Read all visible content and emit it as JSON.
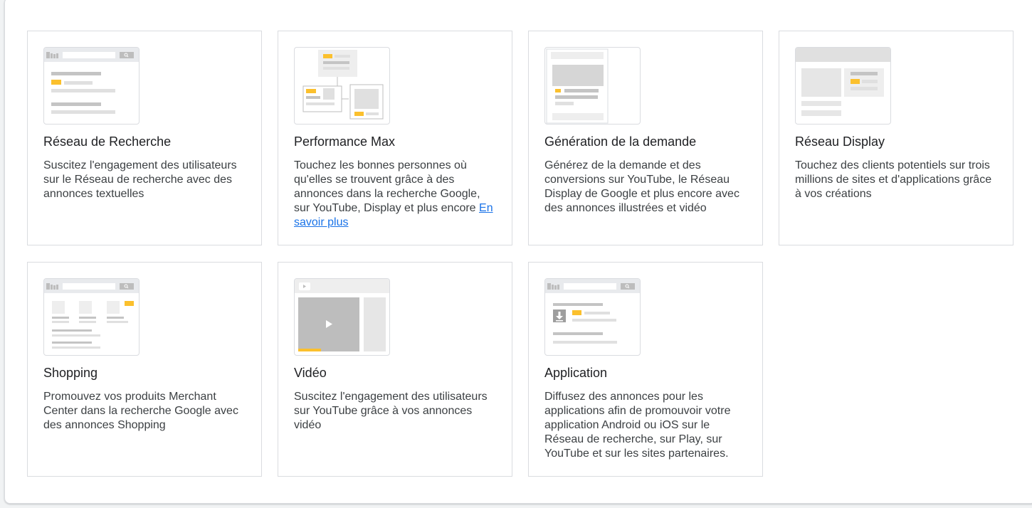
{
  "cards": [
    {
      "title": "Réseau de Recherche",
      "desc": "Suscitez l'engagement des utilisateurs sur le Réseau de recherche avec des annonces textuelles",
      "thumb": "search-network-thumbnail"
    },
    {
      "title": "Performance Max",
      "desc": "Touchez les bonnes personnes où qu'elles se trouvent grâce à des annonces dans la recherche Google, sur YouTube, Display et plus encore",
      "link": "En savoir plus",
      "thumb": "performance-max-thumbnail"
    },
    {
      "title": "Génération de la demande",
      "desc": "Générez de la demande et des conversions sur YouTube, le Réseau Display de Google et plus encore avec des annonces illustrées et vidéo",
      "thumb": "demand-gen-thumbnail"
    },
    {
      "title": "Réseau Display",
      "desc": "Touchez des clients potentiels sur trois millions de sites et d'applications grâce à vos créations",
      "thumb": "display-network-thumbnail"
    },
    {
      "title": "Shopping",
      "desc": "Promouvez vos produits Merchant Center dans la recherche Google avec des annonces Shopping",
      "thumb": "shopping-thumbnail"
    },
    {
      "title": "Vidéo",
      "desc": "Suscitez l'engagement des utilisateurs sur YouTube grâce à vos annonces vidéo",
      "thumb": "video-thumbnail"
    },
    {
      "title": "Application",
      "desc": "Diffusez des annonces pour les applications afin de promouvoir votre application Android ou iOS sur le Réseau de recherche, sur Play, sur YouTube et sur les sites partenaires.",
      "thumb": "app-thumbnail"
    }
  ],
  "colors": {
    "accent_yellow": "#fbc02d",
    "link": "#1a73e8",
    "border": "#dadce0"
  },
  "icons": {
    "search": "search-icon",
    "play": "play-icon",
    "download": "download-icon"
  }
}
